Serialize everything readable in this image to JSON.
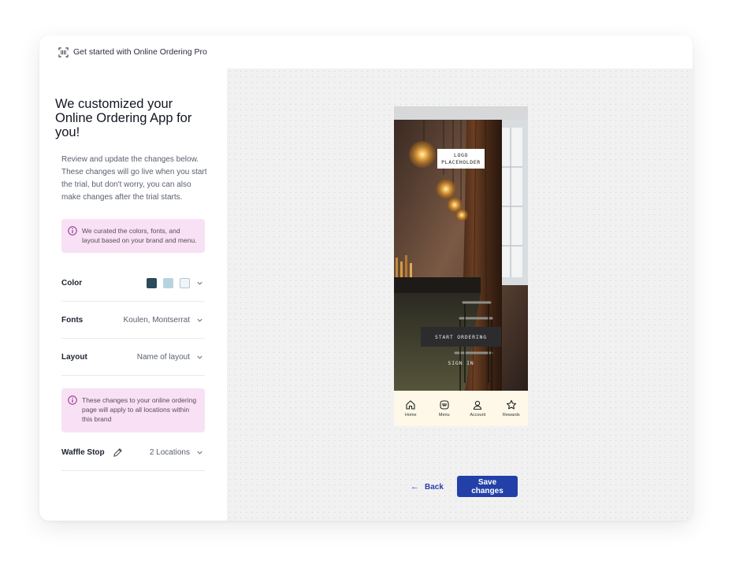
{
  "topbar": {
    "title": "Get started with Online Ordering Pro",
    "icon": "barcode-scan-icon"
  },
  "left": {
    "title": "We customized your Online Ordering App for you!",
    "intro": "Review and update the changes below. These changes will go live when you start the trial, but don't worry, you can also make changes after the trial starts.",
    "note1": "We curated the colors, fonts, and layout based on your brand and menu.",
    "color": {
      "label": "Color",
      "swatches": [
        "#2b4a5a",
        "#b6d4e0",
        "#eef6fa"
      ]
    },
    "fonts": {
      "label": "Fonts",
      "value": "Koulen, Montserrat"
    },
    "layout": {
      "label": "Layout",
      "value": "Name of layout"
    },
    "note2": "These changes to your online ordering page will apply to all locations within this brand",
    "brand": {
      "label": "Waffle Stop",
      "value": "2 Locations"
    }
  },
  "preview": {
    "logo": "LOGO PLACEHOLDER",
    "start_button": "START ORDERING",
    "sign_in": "SIGN IN",
    "tabs": [
      {
        "label": "Home",
        "icon": "home-icon"
      },
      {
        "label": "Menu",
        "icon": "menu-icon"
      },
      {
        "label": "Account",
        "icon": "account-icon"
      },
      {
        "label": "Rewards",
        "icon": "star-icon"
      }
    ]
  },
  "actions": {
    "back": "Back",
    "save": "Save changes"
  },
  "colors": {
    "accent": "#2340a8",
    "note_bg": "#f8e1f4",
    "info": "#8a2a8a",
    "tabbar_bg": "#fdf8e8"
  }
}
